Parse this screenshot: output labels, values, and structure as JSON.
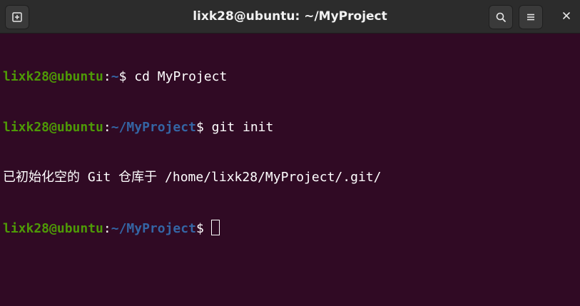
{
  "window": {
    "title": "lixk28@ubuntu: ~/MyProject"
  },
  "headerbar": {
    "newtab_icon": "new-tab-icon",
    "search_icon": "search-icon",
    "menu_icon": "hamburger-menu-icon",
    "close_icon": "close-icon"
  },
  "terminal": {
    "lines": [
      {
        "user": "lixk28@ubuntu",
        "colon": ":",
        "path": "~",
        "dollar": "$",
        "command": " cd MyProject"
      },
      {
        "user": "lixk28@ubuntu",
        "colon": ":",
        "path": "~/MyProject",
        "dollar": "$",
        "command": " git init"
      },
      {
        "output": "已初始化空的 Git 仓库于 /home/lixk28/MyProject/.git/"
      },
      {
        "user": "lixk28@ubuntu",
        "colon": ":",
        "path": "~/MyProject",
        "dollar": "$",
        "command": ""
      }
    ]
  },
  "colors": {
    "background": "#300a24",
    "prompt_user": "#4e9a06",
    "prompt_path": "#3465a4",
    "text": "#ffffff",
    "headerbar": "#2c2c2c"
  }
}
